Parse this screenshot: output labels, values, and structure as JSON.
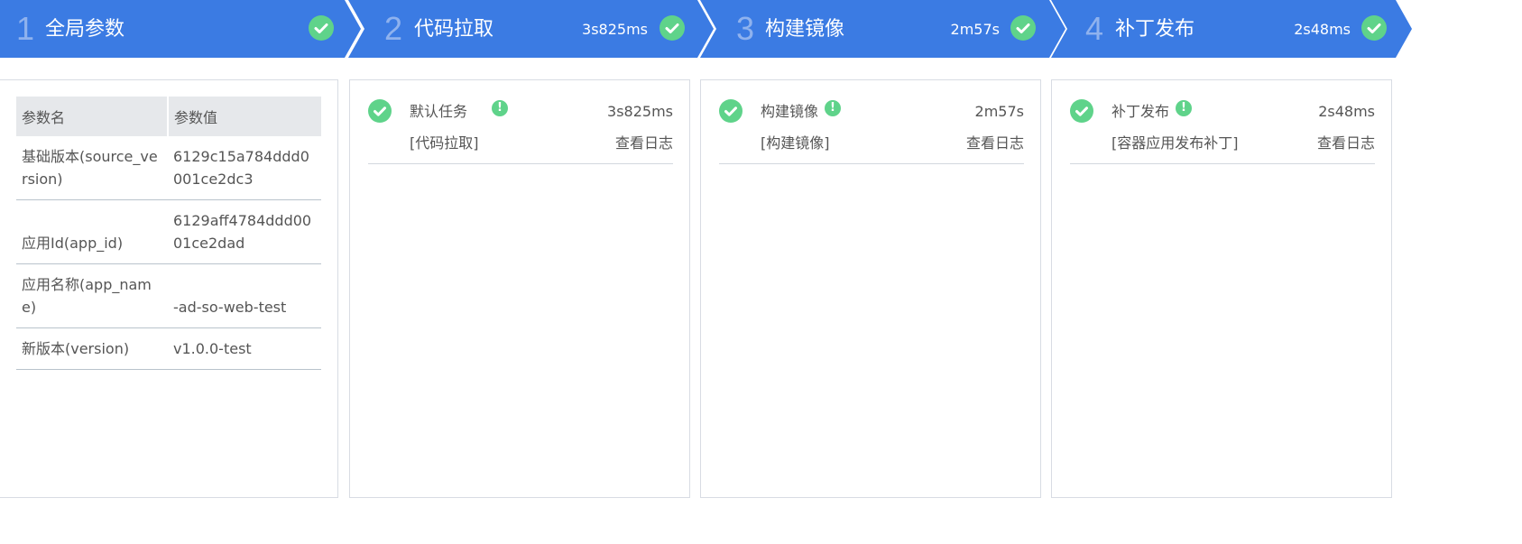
{
  "colors": {
    "stage_bg": "#3b7be3",
    "stage_number": "#8fb2ee",
    "success": "#5fd38a",
    "table_header_bg": "#e6e8eb",
    "panel_border": "#d8dce3"
  },
  "stages": [
    {
      "number": "1",
      "title": "全局参数",
      "duration": "",
      "status_icon": "check-circle-icon"
    },
    {
      "number": "2",
      "title": "代码拉取",
      "duration": "3s825ms",
      "status_icon": "check-circle-icon"
    },
    {
      "number": "3",
      "title": "构建镜像",
      "duration": "2m57s",
      "status_icon": "check-circle-icon"
    },
    {
      "number": "4",
      "title": "补丁发布",
      "duration": "2s48ms",
      "status_icon": "check-circle-icon"
    }
  ],
  "params": {
    "headers": [
      "参数名",
      "参数值"
    ],
    "rows": [
      {
        "name": "基础版本(source_version)",
        "value": "6129c15a784ddd0001ce2dc3"
      },
      {
        "name": "应用Id(app_id)",
        "value": "6129aff4784ddd0001ce2dad"
      },
      {
        "name": "应用名称(app_name)",
        "value": "-ad-so-web-test"
      },
      {
        "name": "新版本(version)",
        "value": "v1.0.0-test"
      }
    ]
  },
  "tasks": [
    {
      "name": "默认任务",
      "info_icon": "!",
      "duration": "3s825ms",
      "subtitle": "[代码拉取]",
      "log_link": "查看日志"
    },
    {
      "name": "构建镜像",
      "info_icon": "!",
      "duration": "2m57s",
      "subtitle": "[构建镜像]",
      "log_link": "查看日志"
    },
    {
      "name": "补丁发布",
      "info_icon": "!",
      "duration": "2s48ms",
      "subtitle": "[容器应用发布补丁]",
      "log_link": "查看日志"
    }
  ]
}
